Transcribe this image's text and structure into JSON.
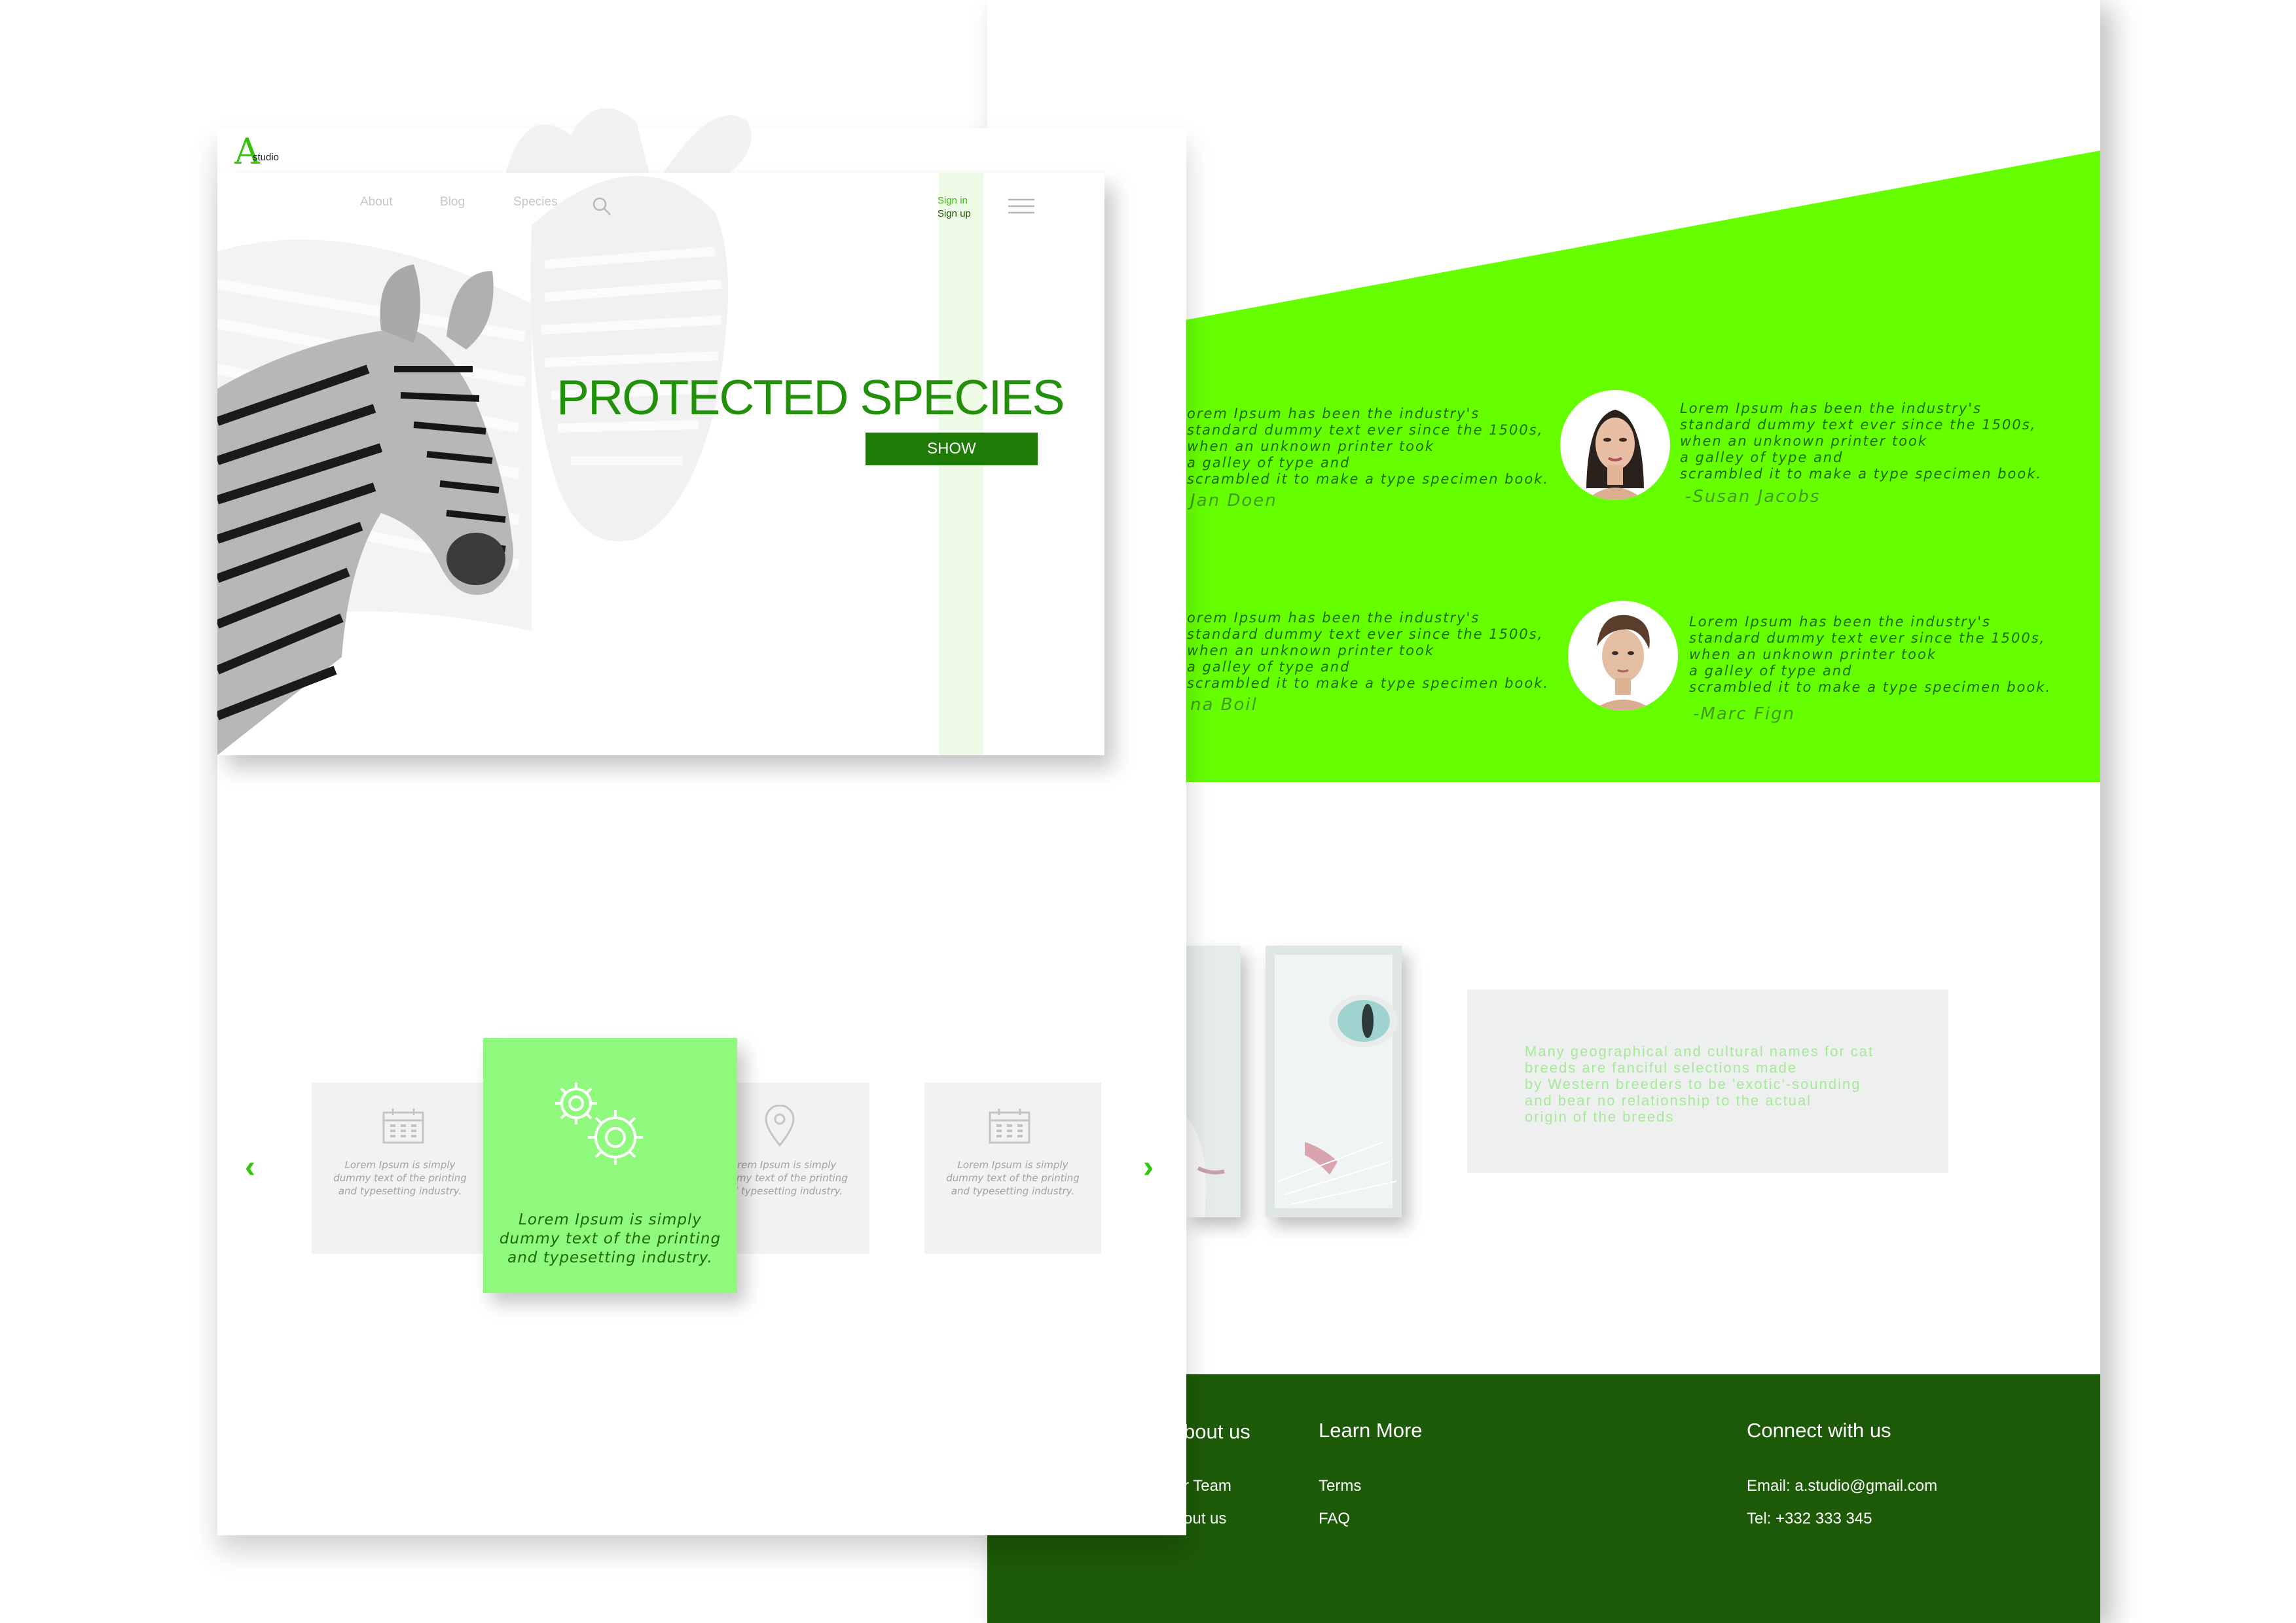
{
  "colors": {
    "accent": "#66ff00",
    "dark_green": "#1d5a07",
    "mid_green": "#1d7b06",
    "light_green": "#8ef97c",
    "text_green": "#1d6a00"
  },
  "brand": {
    "initial": "A",
    "name": "studio"
  },
  "nav": {
    "about": "About",
    "blog": "Blog",
    "species": "Species",
    "sign_in": "Sign in",
    "sign_up": "Sign up"
  },
  "hero": {
    "title": "PROTECTED SPECIES",
    "button": "SHOW"
  },
  "testimonials": [
    {
      "text": "orem Ipsum has been the industry's\nstandard dummy text ever since the 1500s,\nwhen an unknown printer took\na galley of type and\nscrambled it to make a type specimen book.",
      "name": "Jan Doen"
    },
    {
      "text": "Lorem Ipsum has been the industry's\nstandard dummy text ever since the 1500s,\nwhen an unknown printer took\na galley of type and\nscrambled it to make a type specimen book.",
      "name": "-Susan Jacobs"
    },
    {
      "text": "orem Ipsum has been the industry's\nstandard dummy text ever since the 1500s,\nwhen an unknown printer took\na galley of type and\nscrambled it to make a type specimen book.",
      "name": "na Boil"
    },
    {
      "text": "Lorem Ipsum has been the industry's\nstandard dummy text ever since the 1500s,\nwhen an unknown printer took\na galley of type and\nscrambled it to make a type specimen book.",
      "name": "-Marc Fign"
    }
  ],
  "info": {
    "text": "Many geographical and cultural names for cat\nbreeds are fanciful selections made\nby Western breeders to be 'exotic'-sounding\nand bear no relationship to the actual\norigin of the breeds"
  },
  "cards": {
    "small_text": "Lorem Ipsum is simply dummy text of the printing and typesetting industry.",
    "featured_text": "Lorem Ipsum is simply dummy text of the printing and typesetting industry.",
    "icons": [
      "calendar-icon",
      "gears-icon",
      "location-pin-icon",
      "calendar-icon"
    ]
  },
  "footer": {
    "about_heading": "bout us",
    "about_links": [
      "r Team",
      "out us"
    ],
    "learn_heading": "Learn More",
    "learn_links": [
      "Terms",
      "FAQ"
    ],
    "connect_heading": "Connect with us",
    "email": "Email: a.studio@gmail.com",
    "tel": "Tel: +332 333 345"
  }
}
